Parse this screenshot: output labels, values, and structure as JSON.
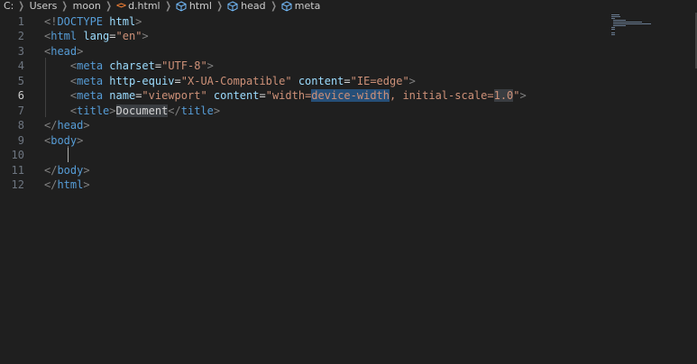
{
  "breadcrumb": {
    "items": [
      {
        "label": "C:",
        "icon": "none"
      },
      {
        "label": "Users",
        "icon": "none"
      },
      {
        "label": "moon",
        "icon": "none"
      },
      {
        "label": "d.html",
        "icon": "html-file-icon"
      },
      {
        "label": "html",
        "icon": "cube-icon"
      },
      {
        "label": "head",
        "icon": "cube-icon"
      },
      {
        "label": "meta",
        "icon": "cube-icon"
      }
    ],
    "html_icon_glyph": "<>"
  },
  "editor": {
    "active_line": 6,
    "lines": [
      {
        "n": "1",
        "parts": [
          [
            "pun",
            "<!"
          ],
          [
            "tag",
            "DOCTYPE"
          ],
          [
            "txt",
            " "
          ],
          [
            "attr",
            "html"
          ],
          [
            "pun",
            ">"
          ]
        ]
      },
      {
        "n": "2",
        "parts": [
          [
            "pun",
            "<"
          ],
          [
            "tag",
            "html"
          ],
          [
            "txt",
            " "
          ],
          [
            "attr",
            "lang"
          ],
          [
            "eq",
            "="
          ],
          [
            "str",
            "\"en\""
          ],
          [
            "pun",
            ">"
          ]
        ]
      },
      {
        "n": "3",
        "parts": [
          [
            "pun",
            "<"
          ],
          [
            "tag",
            "head"
          ],
          [
            "pun",
            ">"
          ]
        ]
      },
      {
        "n": "4",
        "parts": [
          [
            "txt",
            "    "
          ],
          [
            "pun",
            "<"
          ],
          [
            "tag",
            "meta"
          ],
          [
            "txt",
            " "
          ],
          [
            "attr",
            "charset"
          ],
          [
            "eq",
            "="
          ],
          [
            "str",
            "\"UTF-8\""
          ],
          [
            "pun",
            ">"
          ]
        ]
      },
      {
        "n": "5",
        "parts": [
          [
            "txt",
            "    "
          ],
          [
            "pun",
            "<"
          ],
          [
            "tag",
            "meta"
          ],
          [
            "txt",
            " "
          ],
          [
            "attr",
            "http-equiv"
          ],
          [
            "eq",
            "="
          ],
          [
            "str",
            "\"X-UA-Compatible\""
          ],
          [
            "txt",
            " "
          ],
          [
            "attr",
            "content"
          ],
          [
            "eq",
            "="
          ],
          [
            "str",
            "\"IE=edge\""
          ],
          [
            "pun",
            ">"
          ]
        ]
      },
      {
        "n": "6",
        "parts": [
          [
            "txt",
            "    "
          ],
          [
            "pun",
            "<"
          ],
          [
            "tag",
            "meta"
          ],
          [
            "txt",
            " "
          ],
          [
            "attr",
            "name"
          ],
          [
            "eq",
            "="
          ],
          [
            "str",
            "\"viewport\""
          ],
          [
            "txt",
            " "
          ],
          [
            "attr",
            "content"
          ],
          [
            "eq",
            "="
          ],
          [
            "str",
            "\"width="
          ],
          [
            "str sel",
            "device-width"
          ],
          [
            "str",
            ", initial-scale="
          ],
          [
            "str hl",
            "1.0"
          ],
          [
            "str",
            "\""
          ],
          [
            "pun",
            ">"
          ]
        ]
      },
      {
        "n": "7",
        "parts": [
          [
            "txt",
            "    "
          ],
          [
            "pun",
            "<"
          ],
          [
            "tag",
            "title"
          ],
          [
            "pun",
            ">"
          ],
          [
            "txt hl",
            "Document"
          ],
          [
            "pun",
            "</"
          ],
          [
            "tag",
            "title"
          ],
          [
            "pun",
            ">"
          ]
        ]
      },
      {
        "n": "8",
        "parts": [
          [
            "pun",
            "</"
          ],
          [
            "tag",
            "head"
          ],
          [
            "pun",
            ">"
          ]
        ]
      },
      {
        "n": "9",
        "parts": [
          [
            "pun",
            "<"
          ],
          [
            "tag",
            "body"
          ],
          [
            "pun",
            ">"
          ]
        ]
      },
      {
        "n": "10",
        "parts": [
          [
            "txt",
            "    "
          ]
        ]
      },
      {
        "n": "11",
        "parts": [
          [
            "pun",
            "</"
          ],
          [
            "tag",
            "body"
          ],
          [
            "pun",
            ">"
          ]
        ]
      },
      {
        "n": "12",
        "parts": [
          [
            "pun",
            "</"
          ],
          [
            "tag",
            "html"
          ],
          [
            "pun",
            ">"
          ]
        ]
      }
    ]
  },
  "colors": {
    "background": "#1f1f1f",
    "tag": "#569cd6",
    "attribute": "#9cdcfe",
    "string": "#ce9178",
    "selection": "#264f78",
    "line_number": "#6e7681"
  }
}
